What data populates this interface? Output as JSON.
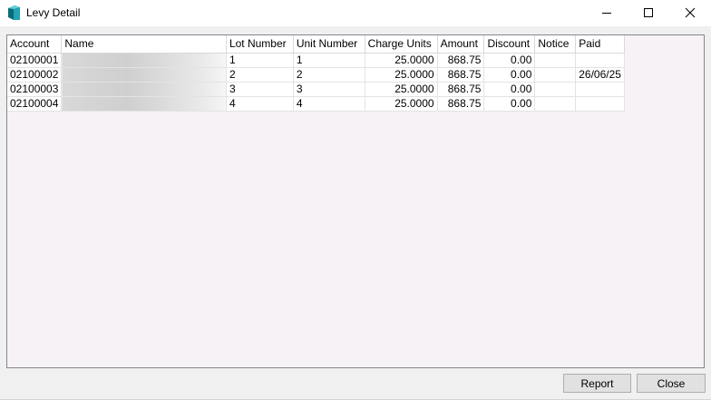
{
  "window": {
    "title": "Levy Detail",
    "accent_color": "#1f7f8c"
  },
  "table": {
    "columns": [
      "Account",
      "Name",
      "Lot Number",
      "Unit Number",
      "Charge Units",
      "Amount",
      "Discount",
      "Notice",
      "Paid"
    ],
    "rows": [
      {
        "account": "02100001",
        "name": "",
        "lot": "1",
        "unit": "1",
        "charge_units": "25.0000",
        "amount": "868.75",
        "discount": "0.00",
        "notice": "",
        "paid": ""
      },
      {
        "account": "02100002",
        "name": "",
        "lot": "2",
        "unit": "2",
        "charge_units": "25.0000",
        "amount": "868.75",
        "discount": "0.00",
        "notice": "",
        "paid": "26/06/25"
      },
      {
        "account": "02100003",
        "name": "",
        "lot": "3",
        "unit": "3",
        "charge_units": "25.0000",
        "amount": "868.75",
        "discount": "0.00",
        "notice": "",
        "paid": ""
      },
      {
        "account": "02100004",
        "name": "",
        "lot": "4",
        "unit": "4",
        "charge_units": "25.0000",
        "amount": "868.75",
        "discount": "0.00",
        "notice": "",
        "paid": ""
      }
    ]
  },
  "buttons": {
    "report": "Report",
    "close": "Close"
  },
  "icons": {
    "app": "app-logo-icon",
    "minimize": "minimize-icon",
    "maximize": "maximize-icon",
    "close": "close-icon"
  }
}
